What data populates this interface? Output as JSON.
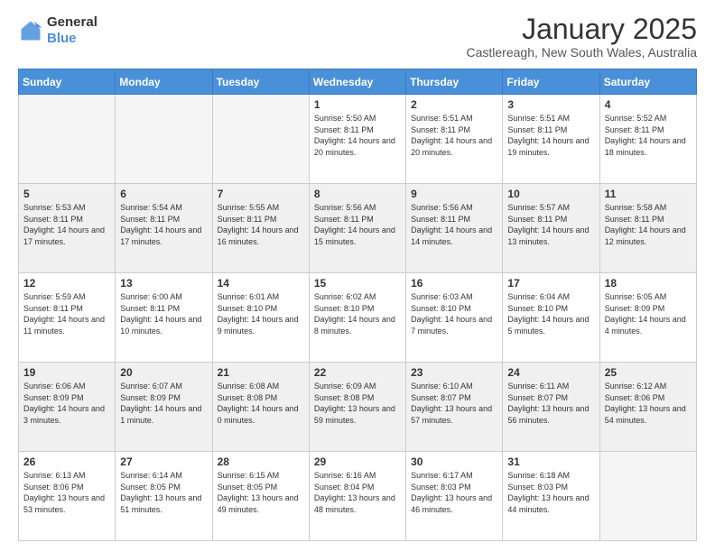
{
  "logo": {
    "general": "General",
    "blue": "Blue"
  },
  "header": {
    "month": "January 2025",
    "location": "Castlereagh, New South Wales, Australia"
  },
  "weekdays": [
    "Sunday",
    "Monday",
    "Tuesday",
    "Wednesday",
    "Thursday",
    "Friday",
    "Saturday"
  ],
  "weeks": [
    [
      {
        "day": "",
        "sunrise": "",
        "sunset": "",
        "daylight": "",
        "empty": true
      },
      {
        "day": "",
        "sunrise": "",
        "sunset": "",
        "daylight": "",
        "empty": true
      },
      {
        "day": "",
        "sunrise": "",
        "sunset": "",
        "daylight": "",
        "empty": true
      },
      {
        "day": "1",
        "sunrise": "Sunrise: 5:50 AM",
        "sunset": "Sunset: 8:11 PM",
        "daylight": "Daylight: 14 hours and 20 minutes."
      },
      {
        "day": "2",
        "sunrise": "Sunrise: 5:51 AM",
        "sunset": "Sunset: 8:11 PM",
        "daylight": "Daylight: 14 hours and 20 minutes."
      },
      {
        "day": "3",
        "sunrise": "Sunrise: 5:51 AM",
        "sunset": "Sunset: 8:11 PM",
        "daylight": "Daylight: 14 hours and 19 minutes."
      },
      {
        "day": "4",
        "sunrise": "Sunrise: 5:52 AM",
        "sunset": "Sunset: 8:11 PM",
        "daylight": "Daylight: 14 hours and 18 minutes."
      }
    ],
    [
      {
        "day": "5",
        "sunrise": "Sunrise: 5:53 AM",
        "sunset": "Sunset: 8:11 PM",
        "daylight": "Daylight: 14 hours and 17 minutes."
      },
      {
        "day": "6",
        "sunrise": "Sunrise: 5:54 AM",
        "sunset": "Sunset: 8:11 PM",
        "daylight": "Daylight: 14 hours and 17 minutes."
      },
      {
        "day": "7",
        "sunrise": "Sunrise: 5:55 AM",
        "sunset": "Sunset: 8:11 PM",
        "daylight": "Daylight: 14 hours and 16 minutes."
      },
      {
        "day": "8",
        "sunrise": "Sunrise: 5:56 AM",
        "sunset": "Sunset: 8:11 PM",
        "daylight": "Daylight: 14 hours and 15 minutes."
      },
      {
        "day": "9",
        "sunrise": "Sunrise: 5:56 AM",
        "sunset": "Sunset: 8:11 PM",
        "daylight": "Daylight: 14 hours and 14 minutes."
      },
      {
        "day": "10",
        "sunrise": "Sunrise: 5:57 AM",
        "sunset": "Sunset: 8:11 PM",
        "daylight": "Daylight: 14 hours and 13 minutes."
      },
      {
        "day": "11",
        "sunrise": "Sunrise: 5:58 AM",
        "sunset": "Sunset: 8:11 PM",
        "daylight": "Daylight: 14 hours and 12 minutes."
      }
    ],
    [
      {
        "day": "12",
        "sunrise": "Sunrise: 5:59 AM",
        "sunset": "Sunset: 8:11 PM",
        "daylight": "Daylight: 14 hours and 11 minutes."
      },
      {
        "day": "13",
        "sunrise": "Sunrise: 6:00 AM",
        "sunset": "Sunset: 8:11 PM",
        "daylight": "Daylight: 14 hours and 10 minutes."
      },
      {
        "day": "14",
        "sunrise": "Sunrise: 6:01 AM",
        "sunset": "Sunset: 8:10 PM",
        "daylight": "Daylight: 14 hours and 9 minutes."
      },
      {
        "day": "15",
        "sunrise": "Sunrise: 6:02 AM",
        "sunset": "Sunset: 8:10 PM",
        "daylight": "Daylight: 14 hours and 8 minutes."
      },
      {
        "day": "16",
        "sunrise": "Sunrise: 6:03 AM",
        "sunset": "Sunset: 8:10 PM",
        "daylight": "Daylight: 14 hours and 7 minutes."
      },
      {
        "day": "17",
        "sunrise": "Sunrise: 6:04 AM",
        "sunset": "Sunset: 8:10 PM",
        "daylight": "Daylight: 14 hours and 5 minutes."
      },
      {
        "day": "18",
        "sunrise": "Sunrise: 6:05 AM",
        "sunset": "Sunset: 8:09 PM",
        "daylight": "Daylight: 14 hours and 4 minutes."
      }
    ],
    [
      {
        "day": "19",
        "sunrise": "Sunrise: 6:06 AM",
        "sunset": "Sunset: 8:09 PM",
        "daylight": "Daylight: 14 hours and 3 minutes."
      },
      {
        "day": "20",
        "sunrise": "Sunrise: 6:07 AM",
        "sunset": "Sunset: 8:09 PM",
        "daylight": "Daylight: 14 hours and 1 minute."
      },
      {
        "day": "21",
        "sunrise": "Sunrise: 6:08 AM",
        "sunset": "Sunset: 8:08 PM",
        "daylight": "Daylight: 14 hours and 0 minutes."
      },
      {
        "day": "22",
        "sunrise": "Sunrise: 6:09 AM",
        "sunset": "Sunset: 8:08 PM",
        "daylight": "Daylight: 13 hours and 59 minutes."
      },
      {
        "day": "23",
        "sunrise": "Sunrise: 6:10 AM",
        "sunset": "Sunset: 8:07 PM",
        "daylight": "Daylight: 13 hours and 57 minutes."
      },
      {
        "day": "24",
        "sunrise": "Sunrise: 6:11 AM",
        "sunset": "Sunset: 8:07 PM",
        "daylight": "Daylight: 13 hours and 56 minutes."
      },
      {
        "day": "25",
        "sunrise": "Sunrise: 6:12 AM",
        "sunset": "Sunset: 8:06 PM",
        "daylight": "Daylight: 13 hours and 54 minutes."
      }
    ],
    [
      {
        "day": "26",
        "sunrise": "Sunrise: 6:13 AM",
        "sunset": "Sunset: 8:06 PM",
        "daylight": "Daylight: 13 hours and 53 minutes."
      },
      {
        "day": "27",
        "sunrise": "Sunrise: 6:14 AM",
        "sunset": "Sunset: 8:05 PM",
        "daylight": "Daylight: 13 hours and 51 minutes."
      },
      {
        "day": "28",
        "sunrise": "Sunrise: 6:15 AM",
        "sunset": "Sunset: 8:05 PM",
        "daylight": "Daylight: 13 hours and 49 minutes."
      },
      {
        "day": "29",
        "sunrise": "Sunrise: 6:16 AM",
        "sunset": "Sunset: 8:04 PM",
        "daylight": "Daylight: 13 hours and 48 minutes."
      },
      {
        "day": "30",
        "sunrise": "Sunrise: 6:17 AM",
        "sunset": "Sunset: 8:03 PM",
        "daylight": "Daylight: 13 hours and 46 minutes."
      },
      {
        "day": "31",
        "sunrise": "Sunrise: 6:18 AM",
        "sunset": "Sunset: 8:03 PM",
        "daylight": "Daylight: 13 hours and 44 minutes."
      },
      {
        "day": "",
        "sunrise": "",
        "sunset": "",
        "daylight": "",
        "empty": true
      }
    ]
  ]
}
